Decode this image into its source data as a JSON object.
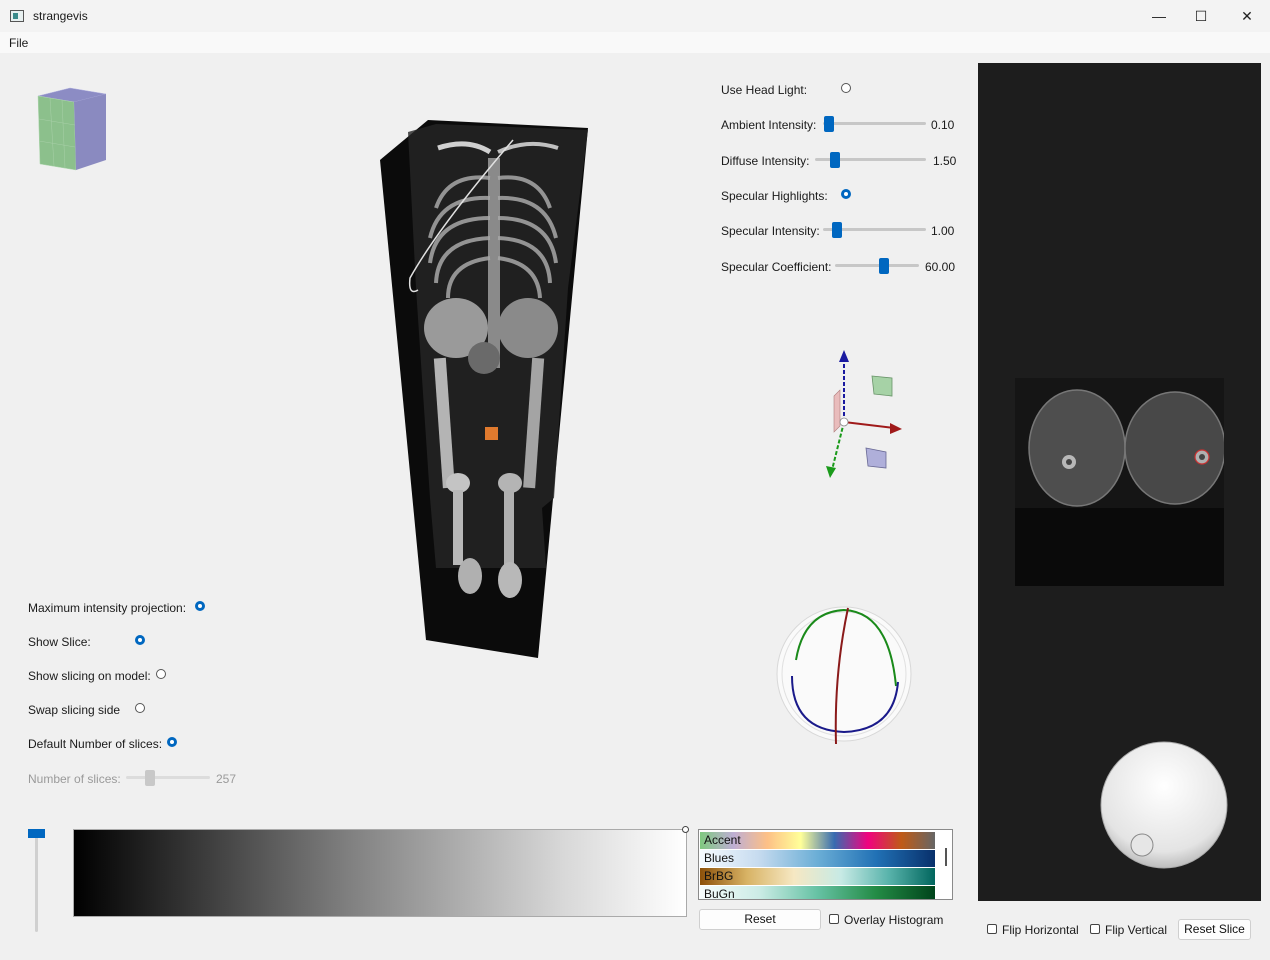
{
  "window": {
    "title": "strangevis",
    "minimize": "—",
    "maximize": "☐",
    "close": "✕"
  },
  "menu": {
    "file": "File"
  },
  "lighting": {
    "head_light": {
      "label": "Use Head Light:",
      "checked": false
    },
    "ambient": {
      "label": "Ambient Intensity:",
      "value": "0.10",
      "fraction": 0.0
    },
    "diffuse": {
      "label": "Diffuse Intensity:",
      "value": "1.50",
      "fraction": 0.15
    },
    "specular_highlights": {
      "label": "Specular Highlights:",
      "checked": true
    },
    "specular_intensity": {
      "label": "Specular Intensity:",
      "value": "1.00",
      "fraction": 0.1
    },
    "specular_coefficient": {
      "label": "Specular Coefficient:",
      "value": "60.00",
      "fraction": 0.58
    }
  },
  "options": {
    "mip": {
      "label": "Maximum intensity projection:",
      "checked": true
    },
    "show_slice": {
      "label": "Show Slice:",
      "checked": true
    },
    "show_slicing_on_model": {
      "label": "Show slicing on model:",
      "checked": false
    },
    "swap_slicing_side": {
      "label": "Swap slicing side",
      "checked": false
    },
    "default_slices": {
      "label": "Default Number of slices:",
      "checked": true
    },
    "num_slices": {
      "label": "Number of slices:",
      "value": "257",
      "fraction": 0.27
    }
  },
  "colormaps": {
    "items": [
      "Accent",
      "Blues",
      "BrBG",
      "BuGn"
    ],
    "reset_label": "Reset",
    "overlay_label": "Overlay Histogram"
  },
  "slice_controls": {
    "flip_horizontal": "Flip Horizontal",
    "flip_vertical": "Flip Vertical",
    "reset_slice": "Reset Slice"
  },
  "colors": {
    "accent": "#0067c0",
    "viewport_bg": "#f0f0f0",
    "slice_bg": "#1d1d1d"
  }
}
